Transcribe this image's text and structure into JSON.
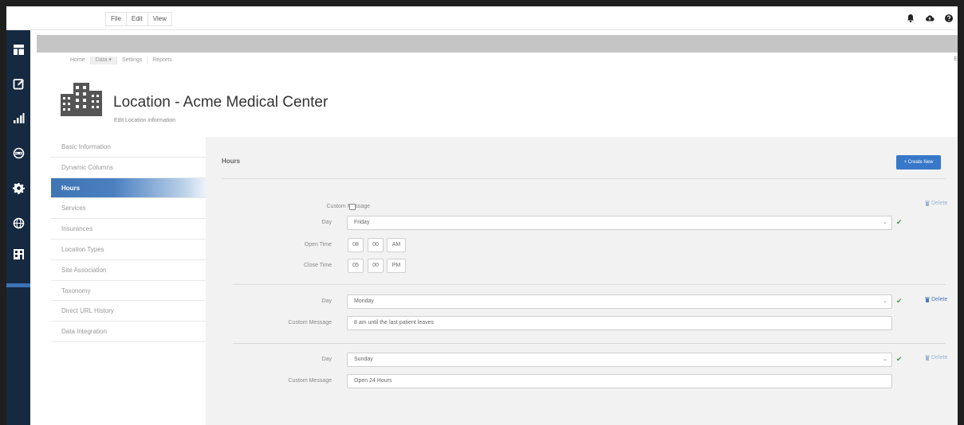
{
  "menubar": {
    "items": [
      "File",
      "Edit",
      "View"
    ],
    "right_icons": [
      "bell-icon",
      "cloud-upload-icon",
      "help-icon"
    ]
  },
  "rail": {
    "icons": [
      "dashboard-icon",
      "edit-icon",
      "bar-chart-icon",
      "network-icon",
      "gear-icon",
      "globe-icon",
      "building-icon"
    ]
  },
  "subnav": {
    "items": [
      "Home",
      "Data ▾",
      "Settings",
      "Reports"
    ],
    "end_marker": "E"
  },
  "header": {
    "title": "Location - Acme Medical Center",
    "subtitle": "Edit Location information"
  },
  "sidenav": {
    "items": [
      "Basic Information",
      "Dynamic Columns",
      "Hours",
      "Services",
      "Insurances",
      "Location Types",
      "Site Association",
      "Taxonomy",
      "Direct URL History",
      "Data Integration"
    ],
    "active": "Hours"
  },
  "panel": {
    "title": "Hours",
    "create_label": "+ Create New"
  },
  "blocks": {
    "first": {
      "custom_message_label": "Custom Message",
      "day_label": "Day",
      "day_value": "Friday",
      "open_label": "Open Time",
      "open_hour": "08",
      "open_min": "00",
      "open_ampm": "AM",
      "close_label": "Close Time",
      "close_hour": "05",
      "close_min": "00",
      "close_ampm": "PM",
      "delete_label": "Delete"
    },
    "second": {
      "day_label": "Day",
      "day_value": "Monday",
      "message_label": "Custom Message",
      "message_value": "8 am until the last patient leaves",
      "delete_label": "Delete"
    },
    "third": {
      "day_label": "Day",
      "day_value": "Sunday",
      "message_label": "Custom Message",
      "message_value": "Open 24 Hours",
      "delete_label": "Delete"
    }
  },
  "colors": {
    "rail": "#152941",
    "accent": "#3878c8",
    "check": "#3c9a3c"
  }
}
